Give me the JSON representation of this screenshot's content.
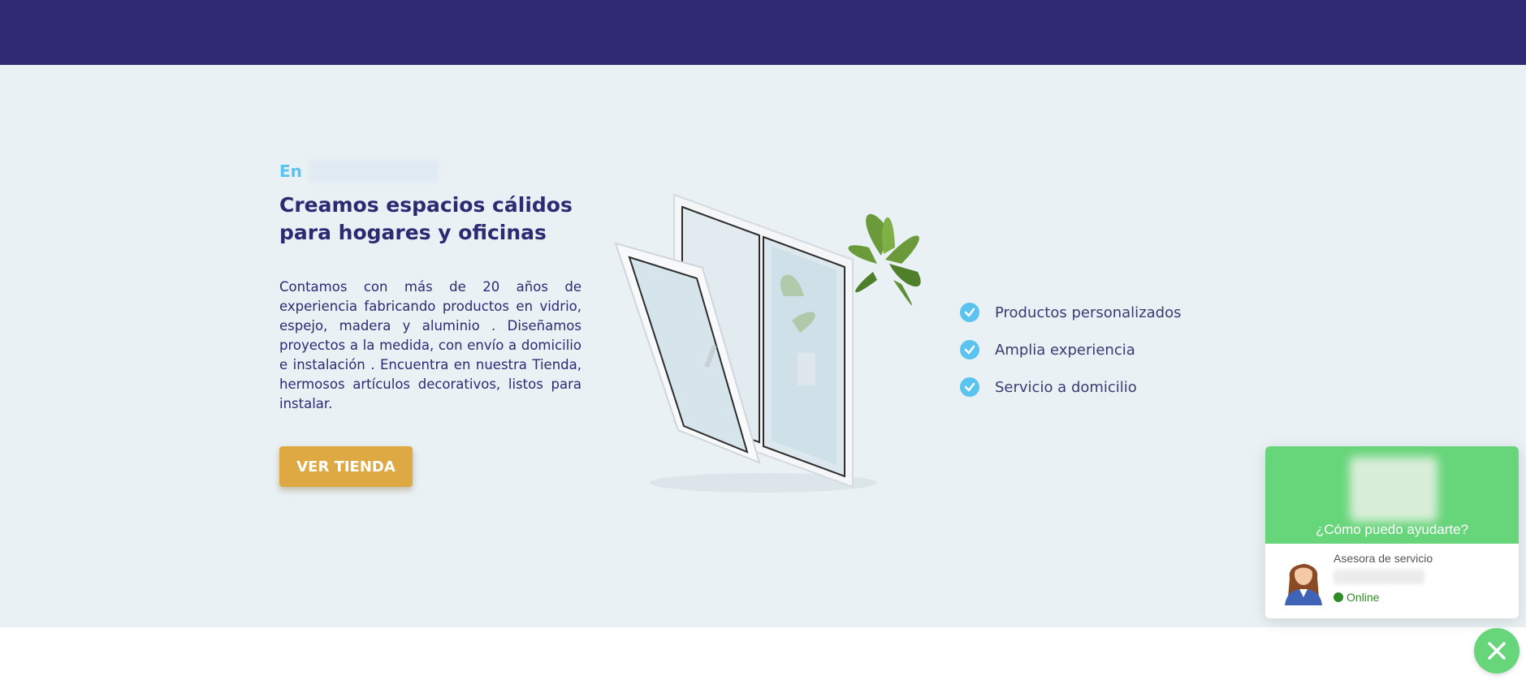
{
  "hero": {
    "kicker": "En",
    "headline_line1": "Creamos espacios cálidos",
    "headline_line2": "para hogares y oficinas",
    "body": "Contamos con más de 20 años de experiencia fabricando productos en vidrio, espejo, madera y aluminio . Diseñamos proyectos a la medida, con envío a domicilio e instalación . Encuentra en nuestra Tienda, hermosos artículos decorativos, listos para instalar.",
    "cta_label": "VER TIENDA"
  },
  "features": [
    {
      "label": "Productos personalizados",
      "icon": "check-circle-icon"
    },
    {
      "label": "Amplia experiencia",
      "icon": "check-circle-icon"
    },
    {
      "label": "Servicio a domicilio",
      "icon": "check-circle-icon"
    }
  ],
  "chat": {
    "question": "¿Cómo puedo ayudarte?",
    "agent_role": "Asesora de servicio",
    "status": "Online"
  },
  "colors": {
    "topbar": "#302a75",
    "hero_bg": "#e9f1f4",
    "accent_blue": "#5bc3ef",
    "headline": "#2e2a72",
    "cta": "#dea843",
    "chat_green": "#67d57a",
    "online_green": "#2f8c24"
  }
}
